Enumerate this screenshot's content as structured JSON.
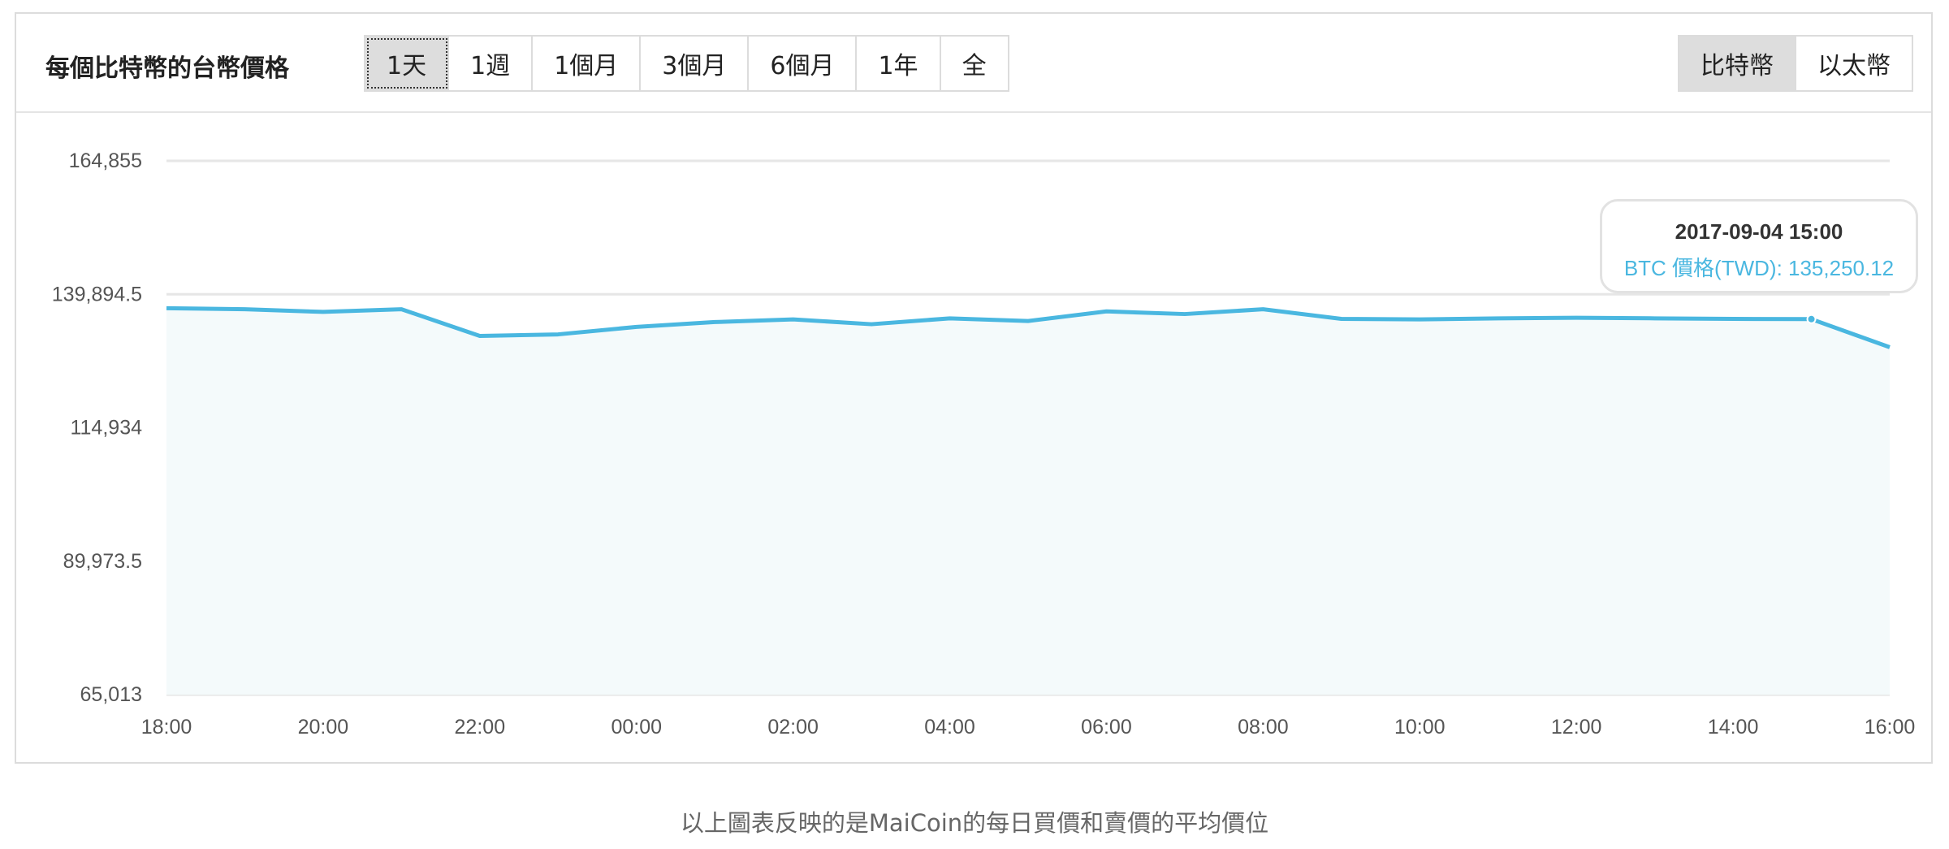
{
  "header": {
    "title": "每個比特幣的台幣價格",
    "range_buttons": [
      "1天",
      "1週",
      "1個月",
      "3個月",
      "6個月",
      "1年",
      "全"
    ],
    "active_range": "1天",
    "coin_buttons": [
      "比特幣",
      "以太幣"
    ],
    "active_coin": "比特幣"
  },
  "chart_data": {
    "type": "area",
    "x": [
      "18:00",
      "19:00",
      "20:00",
      "21:00",
      "22:00",
      "23:00",
      "00:00",
      "01:00",
      "02:00",
      "03:00",
      "04:00",
      "05:00",
      "06:00",
      "07:00",
      "08:00",
      "09:00",
      "10:00",
      "11:00",
      "12:00",
      "13:00",
      "14:00",
      "15:00",
      "16:00"
    ],
    "x_tick_labels": [
      "18:00",
      "20:00",
      "22:00",
      "00:00",
      "02:00",
      "04:00",
      "06:00",
      "08:00",
      "10:00",
      "12:00",
      "14:00",
      "16:00"
    ],
    "y_tick_labels": [
      "164,855",
      "139,894.5",
      "114,934",
      "89,973.5",
      "65,013"
    ],
    "series": [
      {
        "values": [
          137300,
          137100,
          136600,
          137100,
          132100,
          132400,
          133800,
          134700,
          135200,
          134300,
          135400,
          134900,
          136700,
          136200,
          137100,
          135300,
          135200,
          135400,
          135500,
          135400,
          135300,
          135250.12,
          130000
        ]
      }
    ],
    "ylim": [
      65013,
      164855
    ],
    "grid": true,
    "legend": "none",
    "colors": {
      "line": "#4ab7e0",
      "area": "#f4fafb",
      "grid": "#e6e6e6"
    },
    "tooltip": {
      "date": "2017-09-04 15:00",
      "text": "BTC 價格(TWD): 135,250.12"
    }
  },
  "footnote": "以上圖表反映的是MaiCoin的每日買價和賣價的平均價位"
}
